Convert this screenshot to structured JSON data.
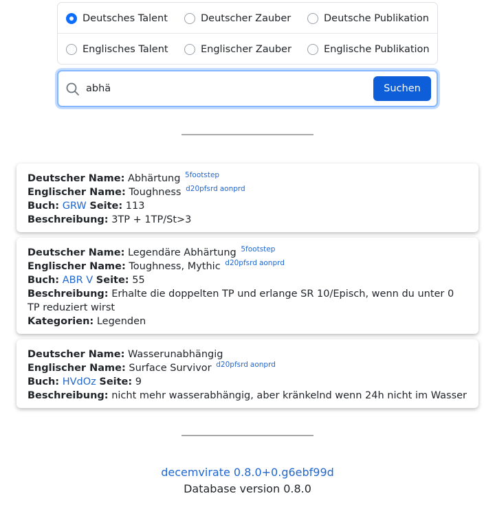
{
  "filters": {
    "row1": [
      {
        "label": "Deutsches Talent",
        "checked": true
      },
      {
        "label": "Deutscher Zauber",
        "checked": false
      },
      {
        "label": "Deutsche Publikation",
        "checked": false
      }
    ],
    "row2": [
      {
        "label": "Englisches Talent",
        "checked": false
      },
      {
        "label": "Englischer Zauber",
        "checked": false
      },
      {
        "label": "Englische Publikation",
        "checked": false
      }
    ]
  },
  "search": {
    "value": "abhä",
    "button_label": "Suchen"
  },
  "field_labels": {
    "german_name": "Deutscher Name:",
    "english_name": "Englischer Name:",
    "book": "Buch:",
    "page": "Seite:",
    "description": "Beschreibung:",
    "categories": "Kategorien:"
  },
  "results": [
    {
      "german_name": "Abhärtung",
      "german_sources": [
        "5footstep"
      ],
      "english_name": "Toughness",
      "english_sources": [
        "d20pfsrd",
        "aonprd"
      ],
      "book": "GRW",
      "page": "113",
      "description": "3TP + 1TP/St>3"
    },
    {
      "german_name": "Legendäre Abhärtung",
      "german_sources": [
        "5footstep"
      ],
      "english_name": "Toughness, Mythic",
      "english_sources": [
        "d20pfsrd",
        "aonprd"
      ],
      "book": "ABR V",
      "page": "55",
      "description": "Erhalte die doppelten TP und erlange SR 10/Episch, wenn du unter 0 TP reduziert wirst",
      "categories": "Legenden"
    },
    {
      "german_name": "Wasserunabhängig",
      "german_sources": [],
      "english_name": "Surface Survivor",
      "english_sources": [
        "d20pfsrd",
        "aonprd"
      ],
      "book": "HVdOz",
      "page": "9",
      "description": "nicht mehr wasserabhängig, aber kränkelnd wenn 24h nicht im Wasser"
    }
  ],
  "footer": {
    "version_link": "decemvirate 0.8.0+0.g6ebf99d",
    "db_version": "Database version 0.8.0"
  },
  "colors": {
    "accent": "#0d6efd",
    "link": "#1f66d1",
    "button": "#0d5ed8"
  }
}
